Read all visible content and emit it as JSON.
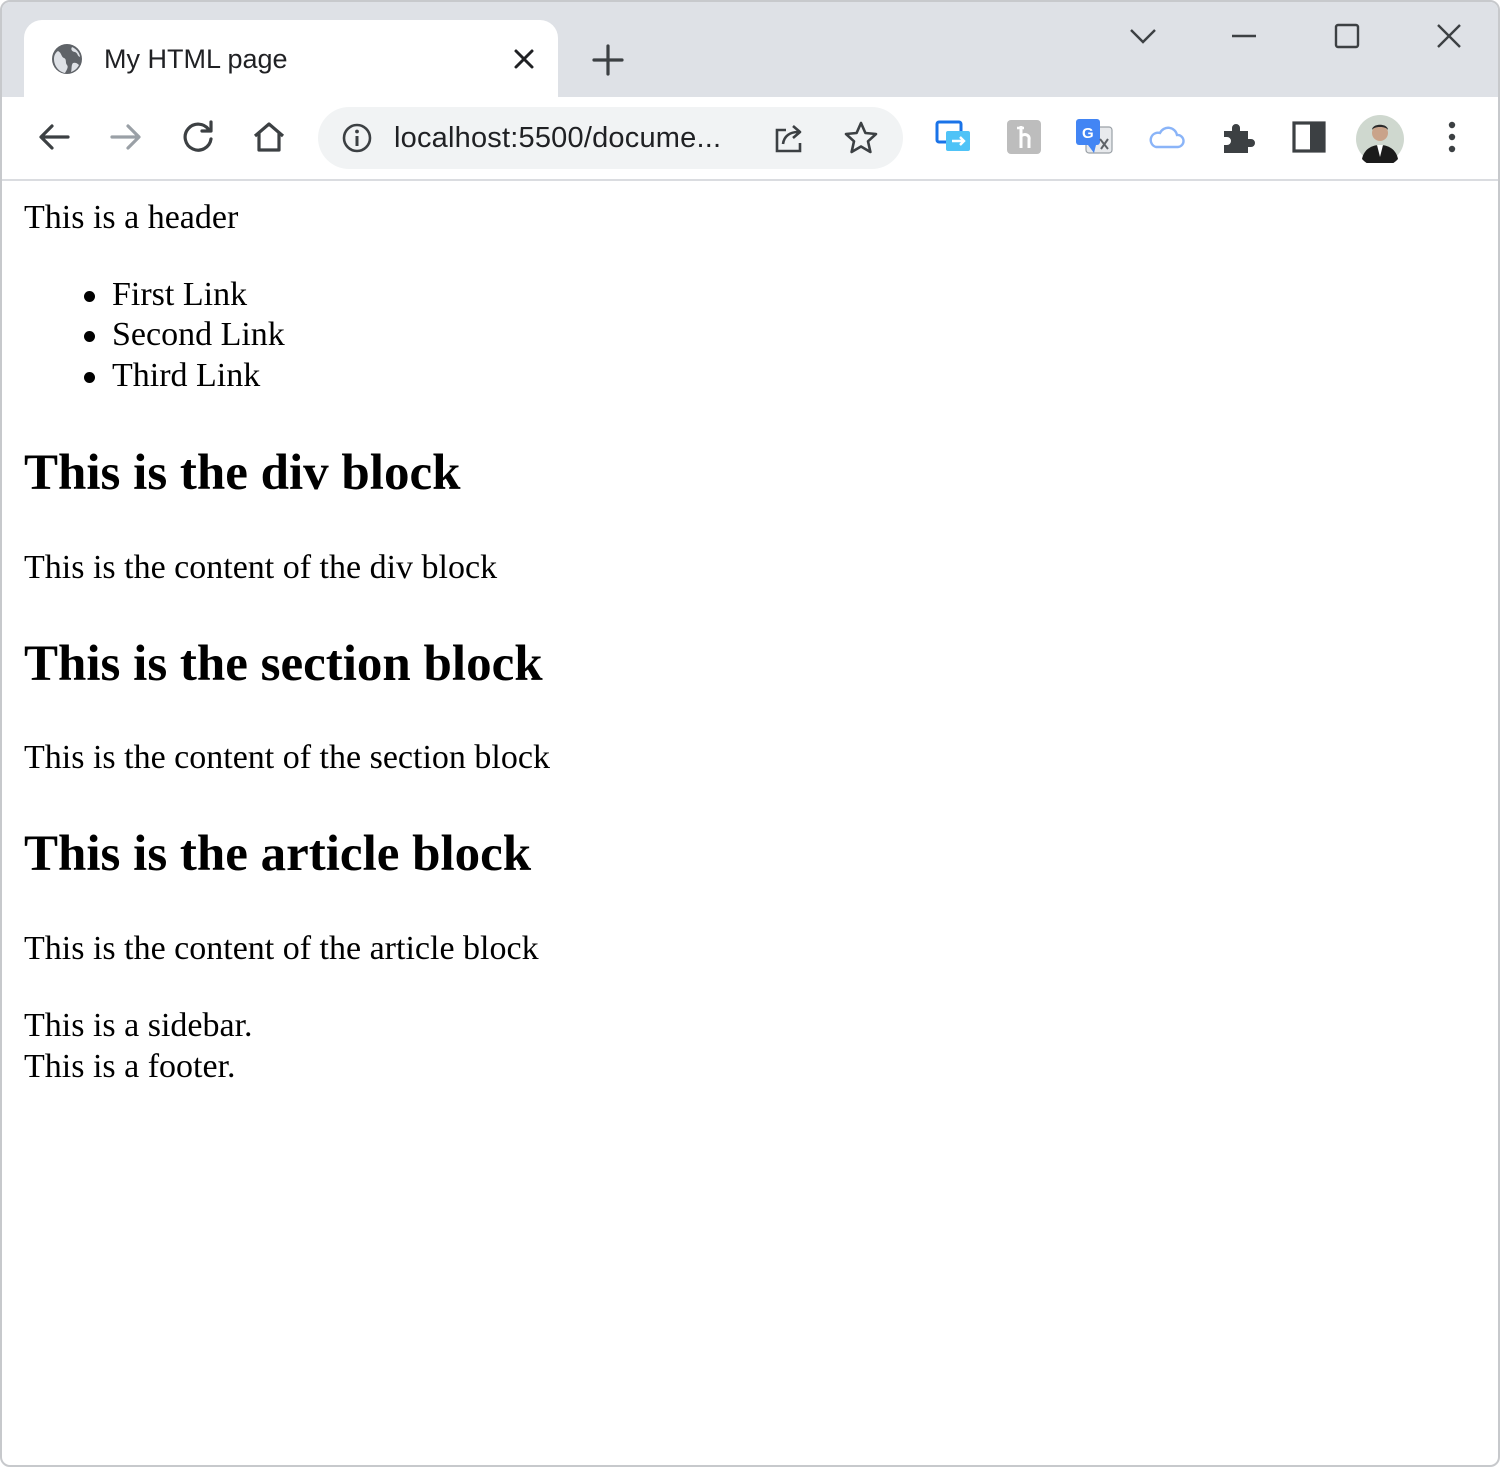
{
  "browser": {
    "tab": {
      "title": "My HTML page",
      "favicon": "globe-icon",
      "close_icon": "close-icon"
    },
    "new_tab_icon": "plus-icon",
    "window_controls": [
      "chevron-down-icon",
      "minimize-icon",
      "maximize-icon",
      "close-icon"
    ],
    "nav": {
      "back_icon": "arrow-left-icon",
      "forward_icon": "arrow-right-icon",
      "reload_icon": "reload-icon",
      "home_icon": "home-icon"
    },
    "omnibox": {
      "url": "localhost:5500/docume...",
      "info_icon": "info-icon",
      "share_icon": "share-icon",
      "bookmark_icon": "star-icon"
    },
    "extensions": [
      "screen-share-extension-icon",
      "gray-extension-icon",
      "google-translate-icon",
      "cloud-icon",
      "puzzle-extensions-icon",
      "side-panel-icon",
      "profile-avatar",
      "kebab-menu-icon"
    ]
  },
  "page": {
    "header": "This is a header",
    "nav_links": [
      "First Link",
      "Second Link",
      "Third Link"
    ],
    "div_heading": "This is the div block",
    "div_content": "This is the content of the div block",
    "section_heading": "This is the section block",
    "section_content": "This is the content of the section block",
    "article_heading": "This is the article block",
    "article_content": "This is the content of the article block",
    "sidebar": "This is a sidebar.",
    "footer": "This is a footer."
  }
}
